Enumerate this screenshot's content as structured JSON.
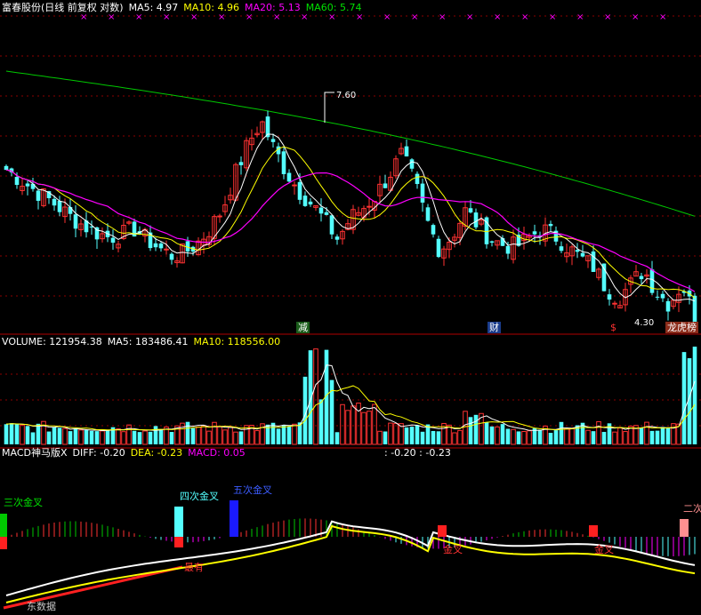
{
  "main_header": {
    "title": "富春股份(日线 前复权 对数)",
    "ma5": "MA5: 4.97",
    "ma10": "MA10: 4.96",
    "ma20": "MA20: 5.13",
    "ma60": "MA60: 5.74"
  },
  "vol_header": {
    "title": "VOLUME: 121954.38",
    "ma5": "MA5: 183486.41",
    "ma10": "MA10: 118556.00"
  },
  "macd_header": {
    "title": "MACD神马版X",
    "diff": "DIFF: -0.20",
    "dea": "DEA: -0.23",
    "macd": "MACD: 0.05",
    "extra": ": -0.20 : -0.23"
  },
  "markers": {
    "high": "7.60",
    "low": "4.30",
    "event_jian": "减",
    "event_cai": "财",
    "event_s": "$",
    "event_longhu": "龙虎榜"
  },
  "signals": {
    "three_cross": "三次金叉",
    "four_cross": "四次金叉",
    "five_cross": "五次金叉",
    "two_cross": "二次",
    "gold_cross_a": "金叉",
    "gold_cross_b": "金叉",
    "strong": "最有",
    "footer": "东数据"
  },
  "colors": {
    "up": "#ff3232",
    "down": "#54ffff",
    "ma5": "#ffffff",
    "ma10": "#ffff00",
    "ma20": "#ff00ff",
    "ma60": "#00c800",
    "grid": "#8b0000"
  },
  "chart_data": [
    {
      "type": "candlestick",
      "title": "富春股份(日线 前复权 对数)",
      "ylim": [
        4.3,
        7.6
      ],
      "scale": "log",
      "series": [
        {
          "name": "MA5",
          "last": 4.97
        },
        {
          "name": "MA10",
          "last": 4.96
        },
        {
          "name": "MA20",
          "last": 5.13
        },
        {
          "name": "MA60",
          "last": 5.74
        }
      ],
      "annotations": [
        {
          "text": "7.60",
          "kind": "period-high"
        },
        {
          "text": "4.30",
          "kind": "period-low"
        }
      ],
      "close_profile": [
        6.35,
        6.2,
        6.05,
        5.92,
        5.78,
        5.62,
        5.5,
        5.4,
        5.33,
        5.36,
        5.45,
        5.3,
        5.18,
        5.08,
        5.12,
        5.25,
        5.45,
        5.75,
        6.3,
        6.8,
        7.2,
        6.7,
        6.3,
        6.0,
        5.8,
        5.55,
        5.3,
        5.6,
        5.75,
        5.95,
        6.25,
        6.6,
        6.15,
        5.55,
        5.15,
        5.35,
        5.7,
        5.5,
        5.3,
        5.22,
        5.2,
        5.32,
        5.45,
        5.35,
        5.2,
        5.05,
        4.95,
        4.68,
        4.55,
        4.72,
        4.9,
        4.62,
        4.48,
        4.72,
        4.35
      ]
    },
    {
      "type": "bar",
      "title": "VOLUME",
      "series": [
        {
          "name": "VOLUME",
          "last": 121954.38
        },
        {
          "name": "MA5",
          "last": 183486.41
        },
        {
          "name": "MA10",
          "last": 118556.0
        }
      ]
    },
    {
      "type": "line",
      "title": "MACD神马版X",
      "series": [
        {
          "name": "DIFF",
          "last": -0.2
        },
        {
          "name": "DEA",
          "last": -0.23
        },
        {
          "name": "MACD",
          "last": 0.05
        }
      ]
    }
  ]
}
